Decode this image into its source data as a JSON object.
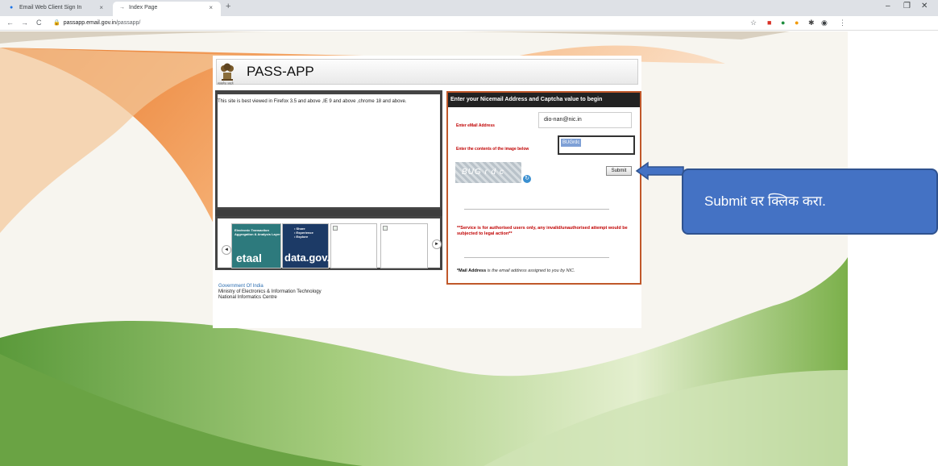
{
  "browser": {
    "tabs": [
      {
        "label": "Email Web Client Sign In",
        "active": false
      },
      {
        "label": "Index Page",
        "active": true
      }
    ],
    "new_tab_glyph": "+",
    "close_glyph": "×",
    "url_host": "passapp.email.gov.in",
    "url_path": "/passapp/",
    "nav_icons": [
      "back-icon",
      "forward-icon",
      "reload-icon"
    ],
    "window_controls": [
      "–",
      "❐",
      "✕"
    ]
  },
  "header": {
    "title": "PASS-APP",
    "emblem_caption": "सत्यमेव जयते"
  },
  "left_panel": {
    "notice": "This site is best viewed in Firefox 3.5 and above ,IE 9 and above ,chrome 18 and above."
  },
  "carousel": {
    "etaal_text": "Electronic Transaction Aggregation & Analysis Layer",
    "etaal_logo": "etaal",
    "datagov_text": "• Share\n• Experience\n• Explore",
    "datagov_logo": "data.gov.in",
    "prev_glyph": "◄",
    "next_glyph": "►"
  },
  "login": {
    "heading": "Enter your Nicemail Address and Captcha value to begin",
    "email_label": "Enter eMail Address",
    "email_value": "dio-nan@nic.in",
    "captcha_label": "Enter the contents of the image below",
    "captcha_value": "BUGrdc",
    "captcha_image_text": "BUG r d c",
    "submit_label": "Submit",
    "warning": "**Service is for authorised users only, any invalid/unauthorised attempt would be subjected to legal action**",
    "mail_address_bold": "*Mail Address",
    "mail_address_rest": " is the email address assigned to you by NIC."
  },
  "footer": {
    "line1": "Government Of India",
    "line2": "Ministry of Electronics & Information Technology",
    "line3": "National Informatics Centre"
  },
  "callout": {
    "text": "Submit वर क्लिक करा."
  },
  "colors": {
    "accent_blue": "#4472c4",
    "warning_red": "#c00000",
    "frame_orange": "#c0582a"
  }
}
